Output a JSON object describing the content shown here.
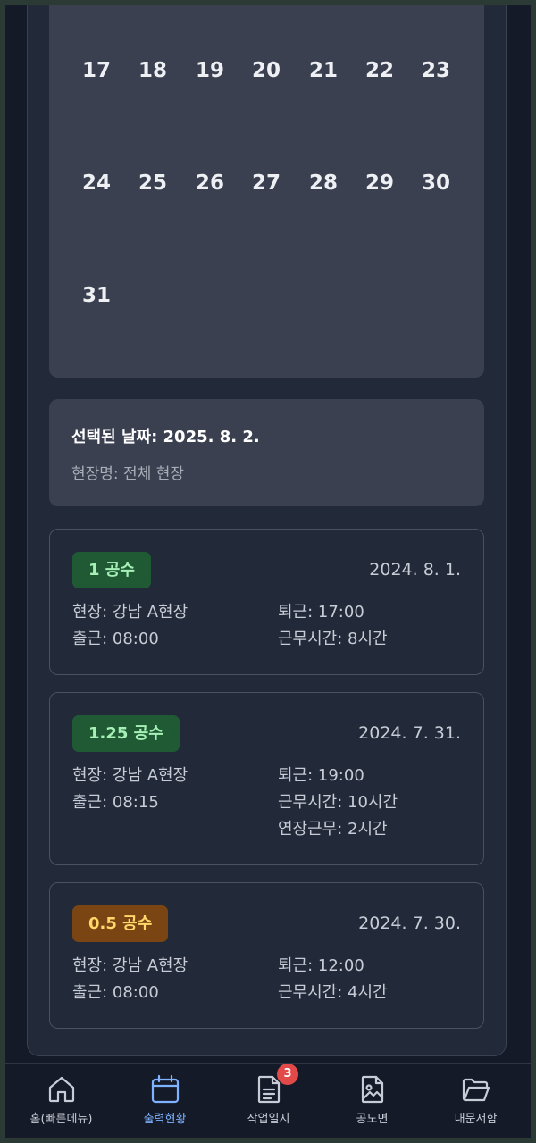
{
  "calendar": {
    "rows": [
      [
        "17",
        "18",
        "19",
        "20",
        "21",
        "22",
        "23"
      ],
      [
        "24",
        "25",
        "26",
        "27",
        "28",
        "29",
        "30"
      ],
      [
        "31"
      ]
    ]
  },
  "selected": {
    "title": "선택된 날짜: 2025. 8. 2.",
    "site": "현장명: 전체 현장"
  },
  "records": [
    {
      "badge": "1 공수",
      "badge_color": "#1f5a34",
      "date": "2024. 8. 1.",
      "site": "현장: 강남 A현장",
      "in": "출근: 08:00",
      "out": "퇴근: 17:00",
      "hours": "근무시간: 8시간",
      "overtime": ""
    },
    {
      "badge": "1.25 공수",
      "badge_color": "#1f5a34",
      "date": "2024. 7. 31.",
      "site": "현장: 강남 A현장",
      "in": "출근: 08:15",
      "out": "퇴근: 19:00",
      "hours": "근무시간: 10시간",
      "overtime": "연장근무: 2시간"
    },
    {
      "badge": "0.5 공수",
      "badge_color": "#7a4512",
      "date": "2024. 7. 30.",
      "site": "현장: 강남 A현장",
      "in": "출근: 08:00",
      "out": "퇴근: 12:00",
      "hours": "근무시간: 4시간",
      "overtime": ""
    }
  ],
  "nav": {
    "items": [
      {
        "label": "홈(빠른메뉴)",
        "icon": "home-icon",
        "active": false
      },
      {
        "label": "출력현황",
        "icon": "calendar-icon",
        "active": true
      },
      {
        "label": "작업일지",
        "icon": "document-icon",
        "active": false,
        "badge": "3"
      },
      {
        "label": "공도면",
        "icon": "drawing-icon",
        "active": false
      },
      {
        "label": "내문서함",
        "icon": "folder-icon",
        "active": false
      }
    ],
    "active_color": "#7fb2ff"
  }
}
